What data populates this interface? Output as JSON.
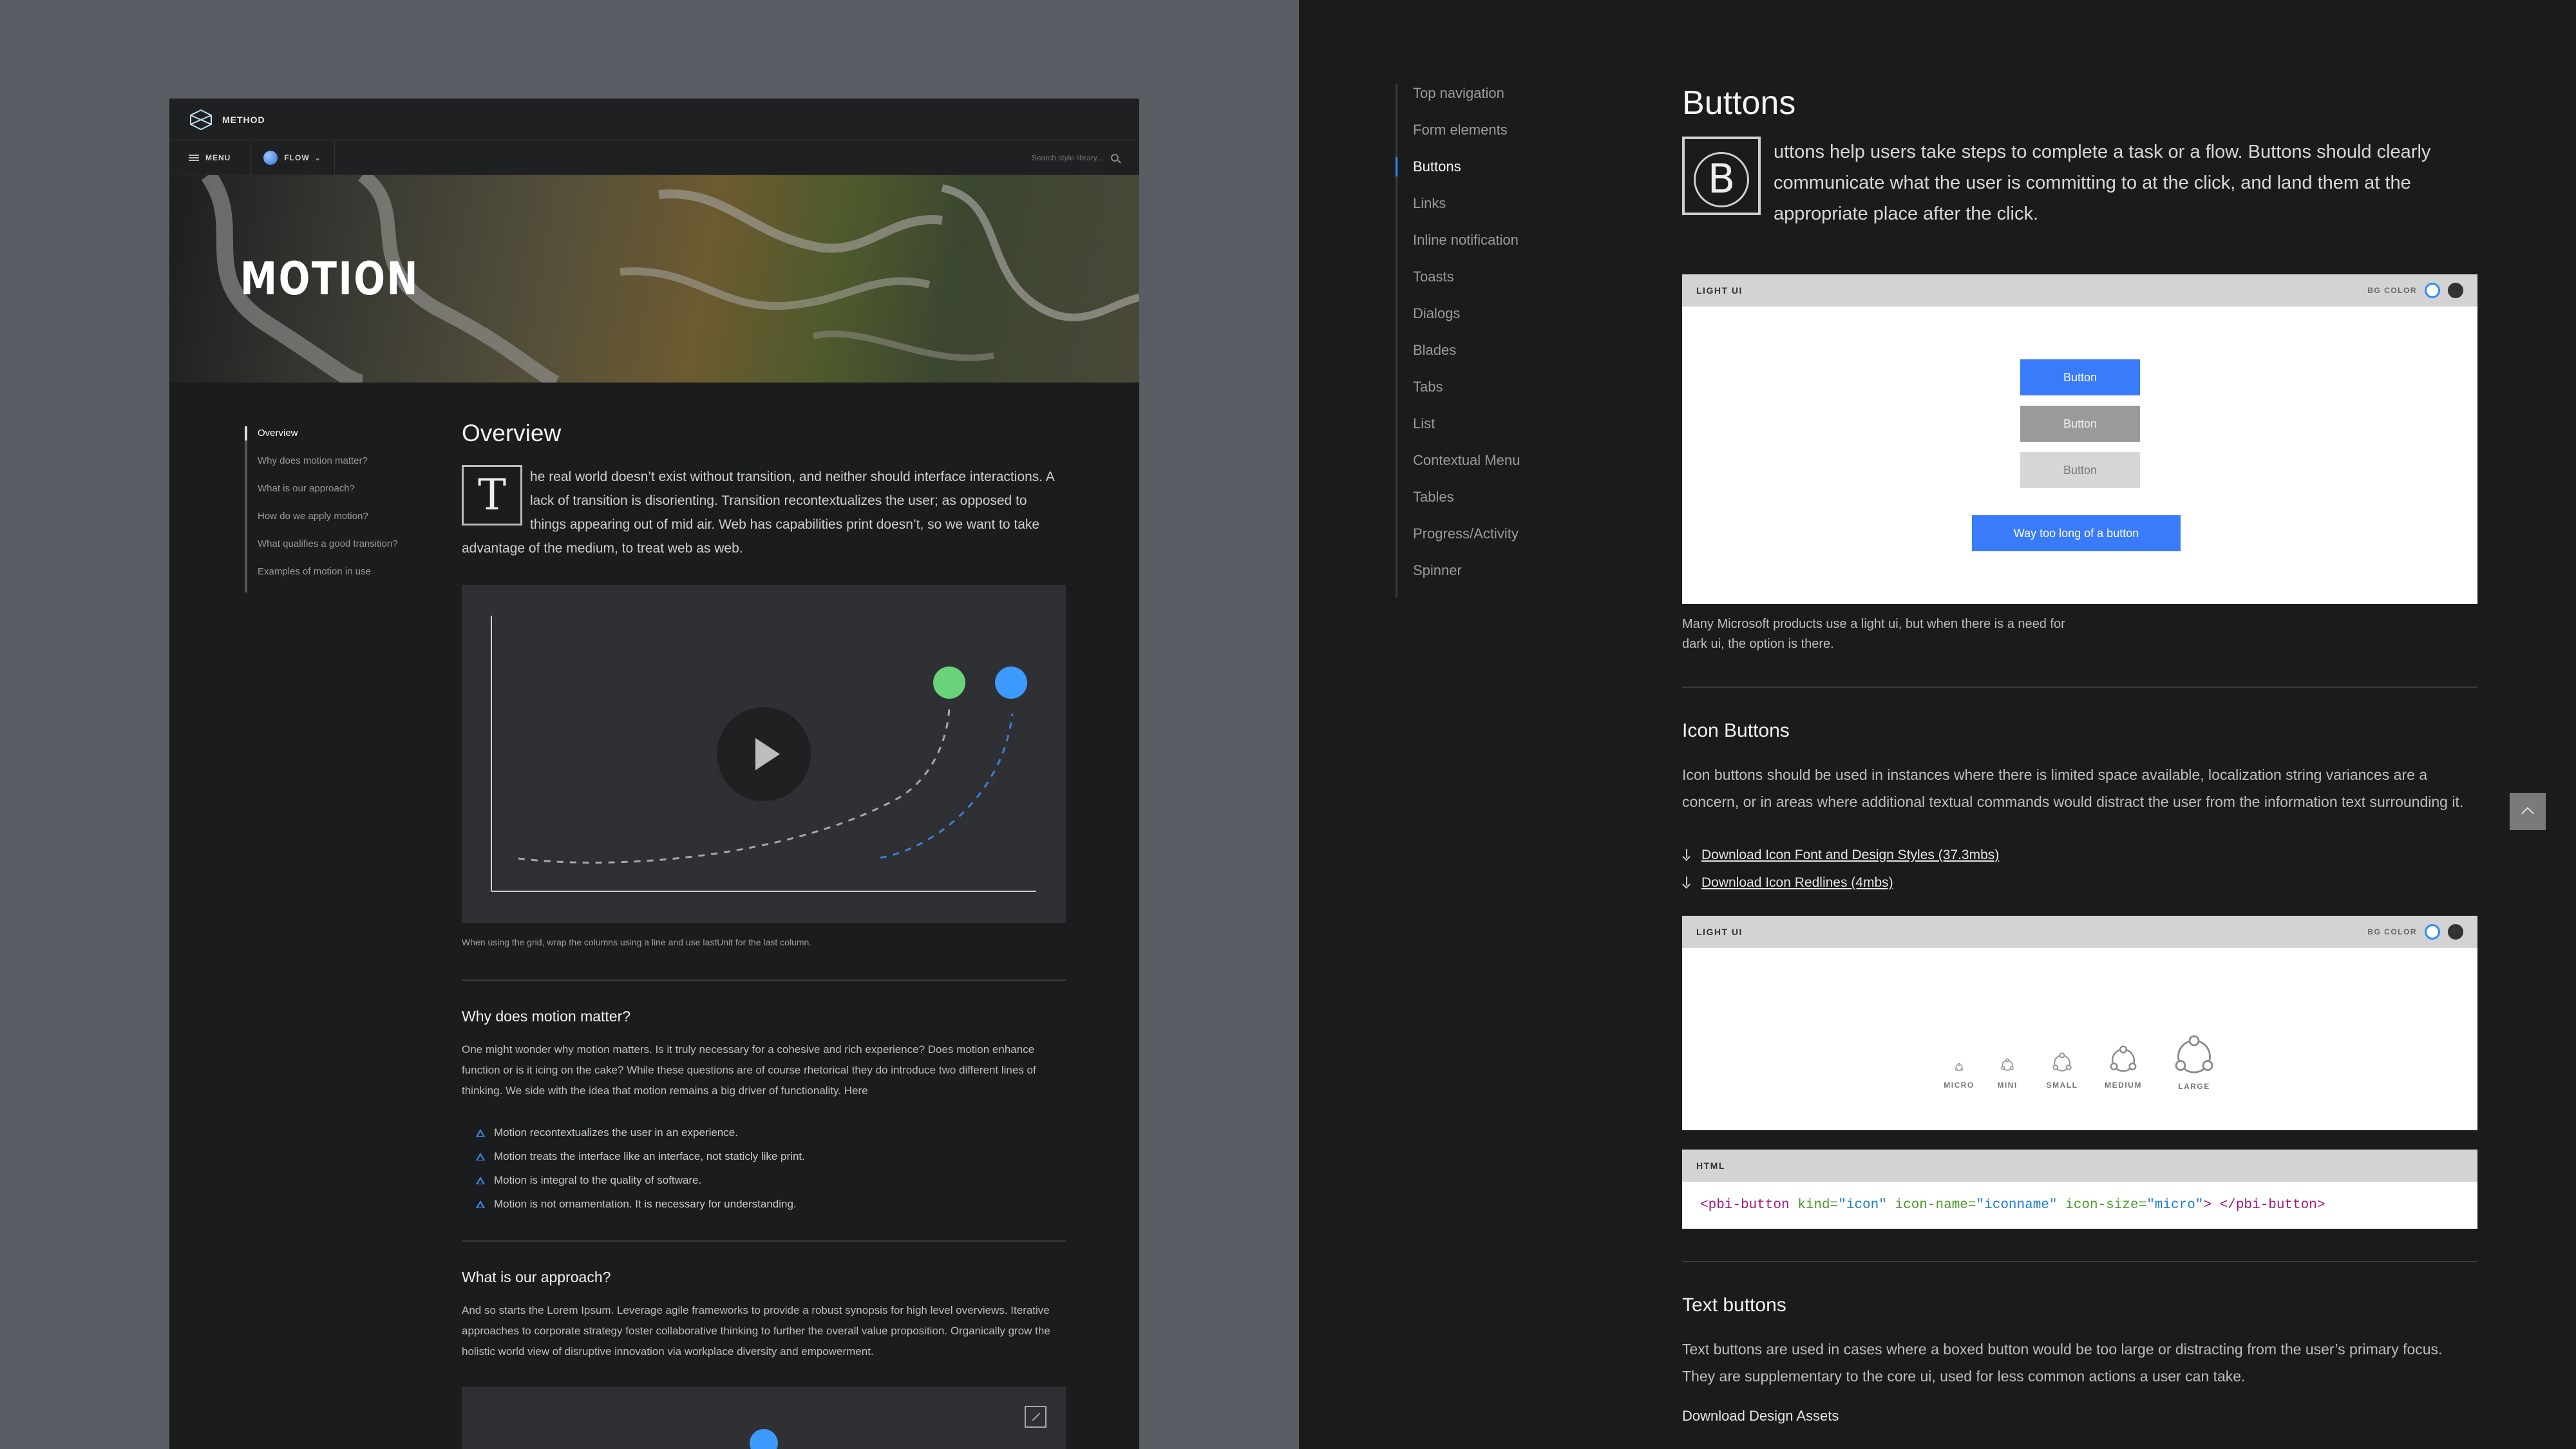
{
  "brand": {
    "name": "METHOD"
  },
  "nav": {
    "menu_label": "MENU",
    "flow_label": "FLOW",
    "search_placeholder": "Search style library..."
  },
  "hero": {
    "title": "MOTION"
  },
  "toc": {
    "items": [
      "Overview",
      "Why does motion matter?",
      "What is our approach?",
      "How do we apply motion?",
      "What qualifies a good transition?",
      "Examples of motion in use"
    ]
  },
  "overview": {
    "title": "Overview",
    "dropcap": "T",
    "text": "he real world doesn’t exist without transition, and neither should interface interactions. A lack of transition is disorienting. Transition recontextualizes the user; as opposed to things appearing out of mid air. Web has capabilities print doesn’t, so we want to take advantage of the medium, to treat web as web.",
    "caption": "When using the grid, wrap the columns using a line and use lastUnit for the last column."
  },
  "why": {
    "title": "Why does motion matter?",
    "text": "One might wonder why motion matters. Is it truly necessary for a cohesive and rich experience? Does motion enhance function or is it icing on the cake? While these questions are of course rhetorical they do introduce two different lines of thinking. We side with the idea that motion remains a big driver of functionality. Here",
    "bullets": [
      "Motion recontextualizes the user in an experience.",
      "Motion treats the interface like an interface, not staticly like print.",
      "Motion is integral to the quality of software.",
      "Motion is not ornamentation. It is necessary for understanding."
    ]
  },
  "approach": {
    "title": "What is our approach?",
    "text": "And so starts the Lorem Ipsum. Leverage agile frameworks to provide a robust synopsis for high level overviews. Iterative approaches to corporate strategy foster collaborative thinking to further the overall value proposition. Organically grow the holistic world view of disruptive innovation via workplace diversity and empowerment."
  },
  "sidenav": {
    "items": [
      "Top navigation",
      "Form elements",
      "Buttons",
      "Links",
      "Inline notification",
      "Toasts",
      "Dialogs",
      "Blades",
      "Tabs",
      "List",
      "Contextual Menu",
      "Tables",
      "Progress/Activity",
      "Spinner"
    ],
    "active_index": 2
  },
  "buttons_section": {
    "title": "Buttons",
    "dropcap": "B",
    "lead": "uttons help users take steps to complete a task or a flow. Buttons should clearly communicate what the user is committing to at the click, and land them at the appropriate place after the click.",
    "demo_label": "LIGHT UI",
    "bg_color_label": "BG COLOR",
    "buttons": [
      "Button",
      "Button",
      "Button",
      "Way too long of a button"
    ],
    "note": "Many Microsoft products use a light ui, but when there is a need for dark ui, the option is there."
  },
  "icon_buttons": {
    "title": "Icon Buttons",
    "text": "Icon buttons should be used in instances where there is limited space available, localization string variances are a concern, or in areas where additional textual commands would distract the user from the information text surrounding it.",
    "downloads": [
      "Download Icon Font and Design Styles (37.3mbs)",
      "Download Icon Redlines (4mbs)"
    ],
    "demo_label": "LIGHT UI",
    "bg_color_label": "BG COLOR",
    "sizes": [
      "MICRO",
      "MINI",
      "SMALL",
      "MEDIUM",
      "LARGE"
    ],
    "code_label": "HTML",
    "code": {
      "open_tag": "<pbi-button",
      "attr1": "kind=",
      "val1": "\"icon\"",
      "attr2": "icon-name=",
      "val2": "\"iconname\"",
      "attr3": "icon-size=",
      "val3": "\"micro\"",
      "close": "> </pbi-button>"
    }
  },
  "text_buttons": {
    "title": "Text buttons",
    "text": "Text buttons are used in cases where a boxed button would be too large or distracting from the user’s primary focus. They are supplementary to the core ui, used for less common actions a user can take.",
    "download": "Download Design Assets"
  },
  "colors": {
    "accent": "#3a7bfa",
    "green_dot": "#69d37c",
    "blue_dot": "#3d9bff"
  }
}
